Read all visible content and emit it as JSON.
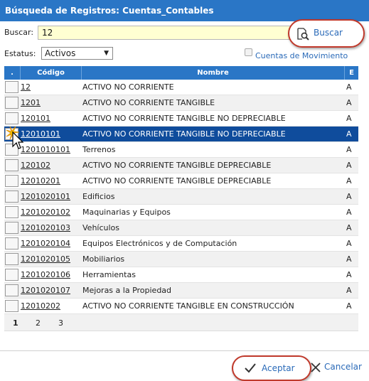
{
  "window": {
    "title": "Búsqueda de Registros: Cuentas_Contables"
  },
  "search": {
    "label": "Buscar:",
    "value": "12",
    "button_label": "Buscar",
    "button_icon": "search-document-icon"
  },
  "filters": {
    "status_label": "Estatus:",
    "status_value": "Activos",
    "movement_label": "Cuentas de Movimiento",
    "movement_checked": false
  },
  "grid": {
    "headers": {
      "dot": ".",
      "code": "Código",
      "name": "Nombre",
      "e": "E"
    },
    "rows": [
      {
        "code": "12",
        "name": "ACTIVO NO CORRIENTE",
        "e": "A"
      },
      {
        "code": "1201",
        "name": "ACTIVO NO CORRIENTE TANGIBLE",
        "e": "A"
      },
      {
        "code": "120101",
        "name": "ACTIVO NO CORRIENTE TANGIBLE NO DEPRECIABLE",
        "e": "A"
      },
      {
        "code": "12010101",
        "name": "ACTIVO NO CORRIENTE TANGIBLE NO DEPRECIABLE",
        "e": "A",
        "selected": true
      },
      {
        "code": "1201010101",
        "name": "Terrenos",
        "e": "A"
      },
      {
        "code": "120102",
        "name": "ACTIVO NO CORRIENTE TANGIBLE DEPRECIABLE",
        "e": "A"
      },
      {
        "code": "12010201",
        "name": "ACTIVO NO CORRIENTE TANGIBLE DEPRECIABLE",
        "e": "A"
      },
      {
        "code": "1201020101",
        "name": "Edificios",
        "e": "A"
      },
      {
        "code": "1201020102",
        "name": "Maquinarias y Equipos",
        "e": "A"
      },
      {
        "code": "1201020103",
        "name": "Vehículos",
        "e": "A"
      },
      {
        "code": "1201020104",
        "name": "Equipos Electrónicos y de Computación",
        "e": "A"
      },
      {
        "code": "1201020105",
        "name": "Mobiliarios",
        "e": "A"
      },
      {
        "code": "1201020106",
        "name": "Herramientas",
        "e": "A"
      },
      {
        "code": "1201020107",
        "name": "Mejoras a la Propiedad",
        "e": "A"
      },
      {
        "code": "12010202",
        "name": "ACTIVO NO CORRIENTE TANGIBLE EN CONSTRUCCIÓN",
        "e": "A"
      }
    ],
    "pages": [
      "1",
      "2",
      "3"
    ],
    "current_page": "1"
  },
  "footer": {
    "accept_label": "Aceptar",
    "cancel_label": "Cancelar"
  },
  "colors": {
    "header_blue": "#2a76c6",
    "selected_row": "#0f4c9c",
    "link_blue": "#2a6ab8",
    "highlight_ring": "#c0392b"
  }
}
